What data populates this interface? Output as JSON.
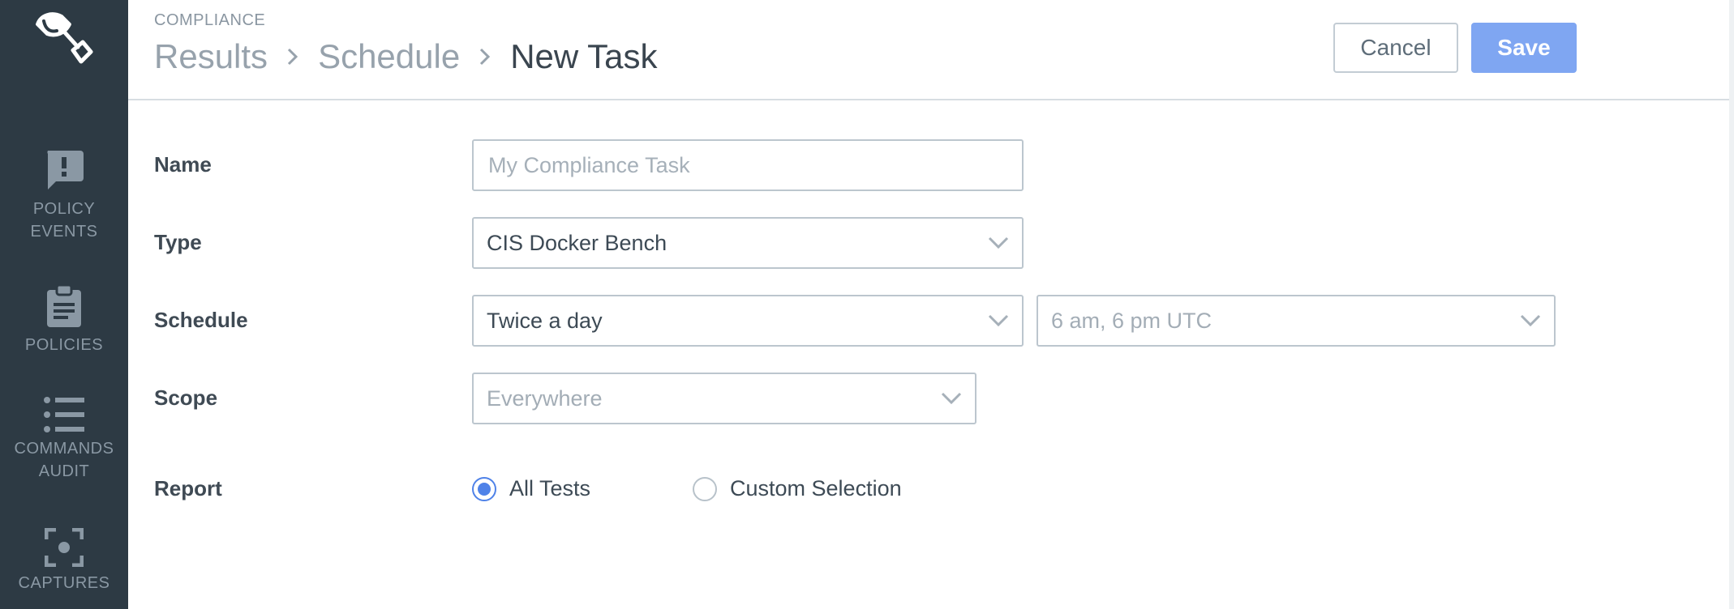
{
  "sidebar": {
    "items": [
      {
        "label_line1": "POLICY",
        "label_line2": "EVENTS",
        "icon": "alert-message-icon"
      },
      {
        "label_line1": "POLICIES",
        "label_line2": "",
        "icon": "clipboard-icon"
      },
      {
        "label_line1": "COMMANDS",
        "label_line2": "AUDIT",
        "icon": "list-icon"
      },
      {
        "label_line1": "CAPTURES",
        "label_line2": "",
        "icon": "capture-icon"
      }
    ]
  },
  "header": {
    "section": "COMPLIANCE",
    "breadcrumb": [
      "Results",
      "Schedule",
      "New Task"
    ],
    "cancel_label": "Cancel",
    "save_label": "Save"
  },
  "form": {
    "name": {
      "label": "Name",
      "value": "",
      "placeholder": "My Compliance Task"
    },
    "type": {
      "label": "Type",
      "value": "CIS Docker Bench"
    },
    "schedule": {
      "label": "Schedule",
      "frequency": "Twice a day",
      "time": "6 am, 6 pm UTC"
    },
    "scope": {
      "label": "Scope",
      "value": "Everywhere"
    },
    "report": {
      "label": "Report",
      "options": [
        "All Tests",
        "Custom Selection"
      ],
      "selected": "All Tests"
    }
  },
  "colors": {
    "sidebar_bg": "#2d3a44",
    "accent": "#4f82e8",
    "save_button": "#7fa6f2"
  }
}
